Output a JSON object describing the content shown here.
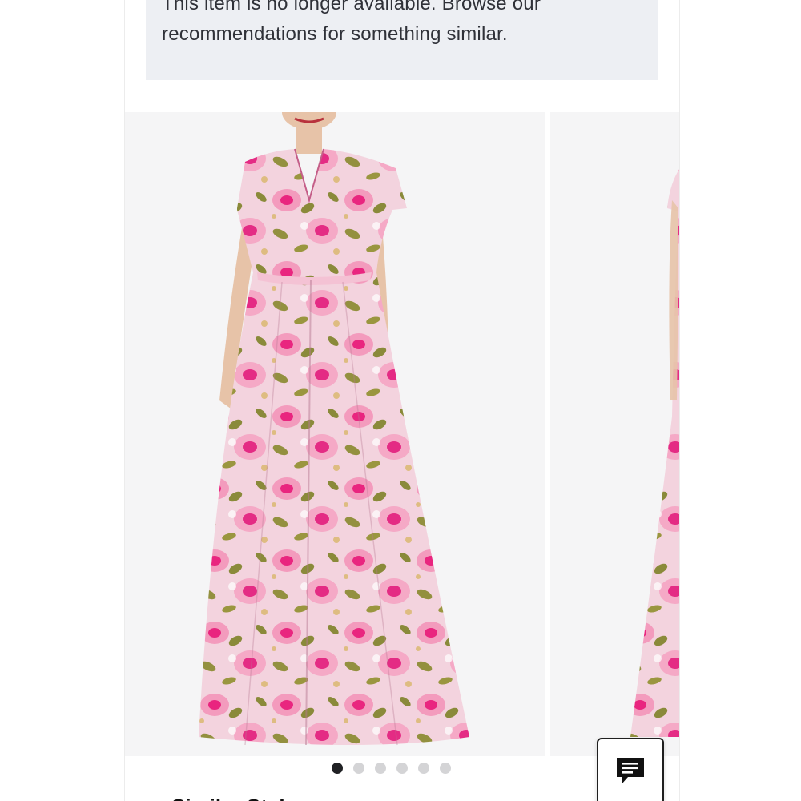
{
  "notice": {
    "line1": "This item is no longer available. Browse our",
    "line2": "recommendations for something similar."
  },
  "carousel": {
    "total_slides": 6,
    "active_index": 0,
    "slides": [
      {
        "image": "floral-jacquard-gown-front"
      },
      {
        "image": "floral-jacquard-gown-side"
      }
    ]
  },
  "section": {
    "heading": "Similar Styles"
  },
  "chat": {
    "icon": "chat-icon"
  },
  "colors": {
    "notice_bg": "#edeff3",
    "active_dot": "#202124",
    "inactive_dot": "#d4d4d6",
    "dress_pink": "#f6c6d6",
    "dress_magenta": "#ea2a86",
    "dress_olive": "#8b8b3c"
  }
}
